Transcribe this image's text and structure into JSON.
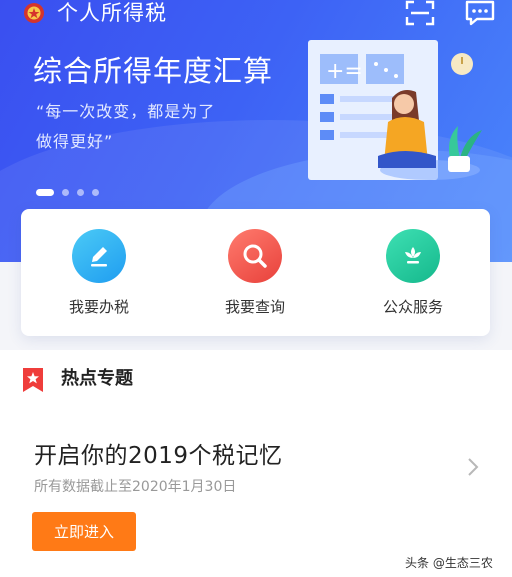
{
  "header": {
    "app_title": "个人所得税",
    "emblem_icon": "tax-emblem-icon",
    "scan_icon": "scan-icon",
    "message_icon": "message-icon"
  },
  "banner": {
    "title": "综合所得年度汇算",
    "quote_line1": "“每一次改变，都是为了",
    "quote_line2": "做得更好”",
    "slides_count": 4,
    "active_slide": 1
  },
  "actions": [
    {
      "label": "我要办税",
      "icon": "pencil-icon",
      "color": "#2bb2f0"
    },
    {
      "label": "我要查询",
      "icon": "search-icon",
      "color": "#f0554a"
    },
    {
      "label": "公众服务",
      "icon": "flower-icon",
      "color": "#24c9a0"
    }
  ],
  "hot_topics": {
    "heading": "热点专题",
    "item_title": "开启你的2019个税记忆",
    "item_subtitle": "所有数据截止至2020年1月30日",
    "button_label": "立即进入"
  },
  "watermark": "头条 @生态三农",
  "colors": {
    "banner": "#3d5ff3",
    "accent_orange": "#ff7a16",
    "hot_red": "#ef3d3b"
  }
}
